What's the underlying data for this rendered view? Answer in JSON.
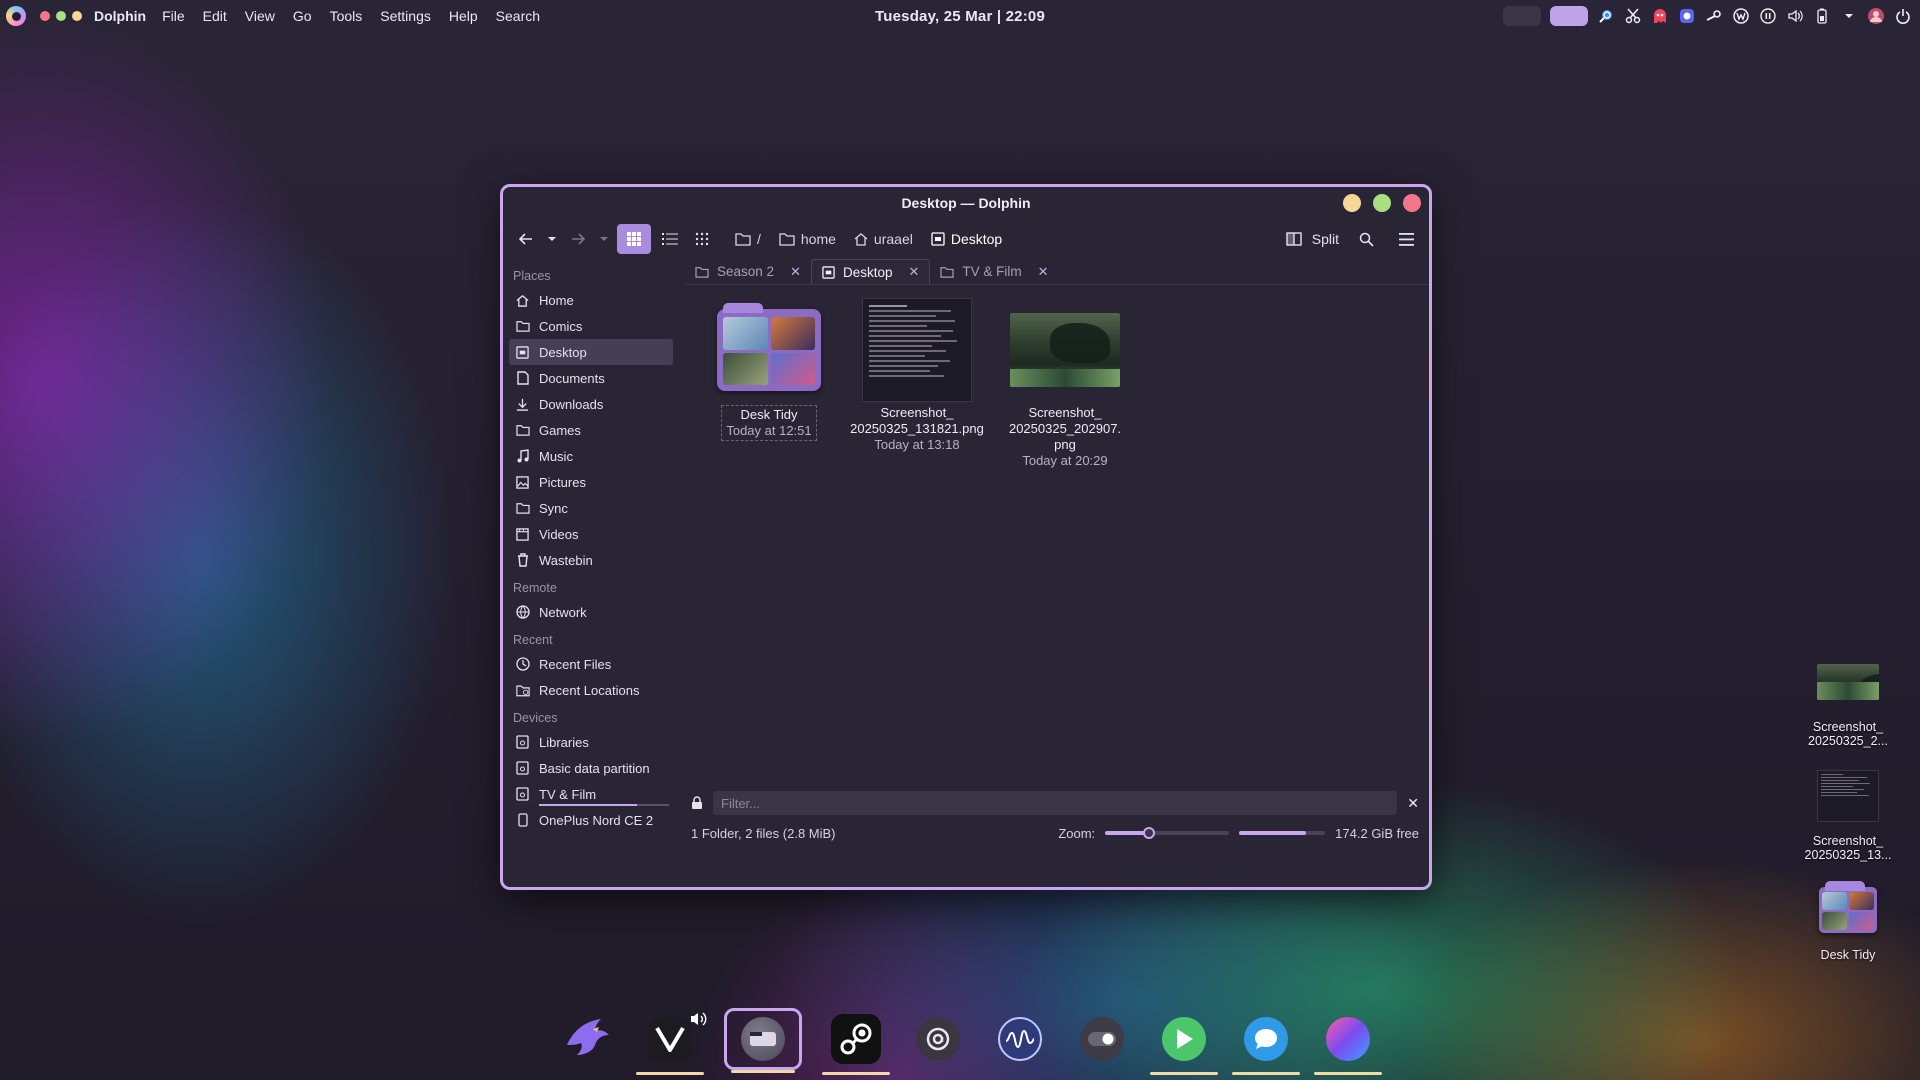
{
  "top_panel": {
    "app_name": "Dolphin",
    "menu": [
      "File",
      "Edit",
      "View",
      "Go",
      "Tools",
      "Settings",
      "Help",
      "Search"
    ],
    "clock": "Tuesday, 25 Mar | 22:09"
  },
  "window": {
    "title": "Desktop — Dolphin",
    "breadcrumb": {
      "root": "/",
      "home": "home",
      "user": "uraael",
      "current": "Desktop"
    },
    "split_label": "Split",
    "sidebar": {
      "places_header": "Places",
      "places": [
        {
          "label": "Home",
          "icon": "home-icon"
        },
        {
          "label": "Comics",
          "icon": "folder-icon"
        },
        {
          "label": "Desktop",
          "icon": "desktop-icon",
          "selected": true
        },
        {
          "label": "Documents",
          "icon": "document-icon"
        },
        {
          "label": "Downloads",
          "icon": "download-icon"
        },
        {
          "label": "Games",
          "icon": "folder-icon"
        },
        {
          "label": "Music",
          "icon": "music-icon"
        },
        {
          "label": "Pictures",
          "icon": "picture-icon"
        },
        {
          "label": "Sync",
          "icon": "folder-icon"
        },
        {
          "label": "Videos",
          "icon": "video-icon"
        },
        {
          "label": "Wastebin",
          "icon": "trash-icon"
        }
      ],
      "remote_header": "Remote",
      "remote": [
        {
          "label": "Network",
          "icon": "network-icon"
        }
      ],
      "recent_header": "Recent",
      "recent": [
        {
          "label": "Recent Files",
          "icon": "clock-icon"
        },
        {
          "label": "Recent Locations",
          "icon": "recent-folder-icon"
        }
      ],
      "devices_header": "Devices",
      "devices": [
        {
          "label": "Libraries",
          "icon": "drive-icon"
        },
        {
          "label": "Basic data partition",
          "icon": "drive-icon"
        },
        {
          "label": "TV & Film",
          "icon": "drive-icon",
          "usage": 0.75
        },
        {
          "label": "OnePlus Nord CE 2",
          "icon": "phone-icon"
        }
      ]
    },
    "tabs": [
      {
        "label": "Season 2",
        "icon": "folder-icon",
        "active": false
      },
      {
        "label": "Desktop",
        "icon": "desktop-icon",
        "active": true
      },
      {
        "label": "TV & Film",
        "icon": "folder-icon",
        "active": false
      }
    ],
    "files": [
      {
        "name": "Desk Tidy",
        "date": "Today at 12:51",
        "kind": "folder"
      },
      {
        "name": "Screenshot_\n20250325_131821.png",
        "name1": "Screenshot_",
        "name2": "20250325_131821.png",
        "date": "Today at 13:18",
        "kind": "doc"
      },
      {
        "name1": "Screenshot_",
        "name2": "20250325_202907.",
        "name3": "png",
        "date": "Today at 20:29",
        "kind": "image"
      }
    ],
    "filter_placeholder": "Filter...",
    "status": {
      "summary": "1 Folder, 2 files (2.8 MiB)",
      "zoom_label": "Zoom:",
      "zoom_level": 0.35,
      "free_space": "174.2 GiB free",
      "used_fraction": 0.78
    }
  },
  "desktop_icons": [
    {
      "line1": "Screenshot_",
      "line2": "20250325_2...",
      "kind": "image"
    },
    {
      "line1": "Screenshot_",
      "line2": "20250325_13...",
      "kind": "doc"
    },
    {
      "line1": "Desk Tidy",
      "line2": "",
      "kind": "folder"
    }
  ],
  "dock": [
    {
      "name": "eagle-browser-icon"
    },
    {
      "name": "vivaldi-icon"
    },
    {
      "name": "dolphin-icon",
      "active": true
    },
    {
      "name": "steam-icon"
    },
    {
      "name": "at-sign-app-icon"
    },
    {
      "name": "waveform-app-icon"
    },
    {
      "name": "toggle-app-icon"
    },
    {
      "name": "play-store-icon"
    },
    {
      "name": "chat-app-icon"
    },
    {
      "name": "gradient-app-icon"
    }
  ],
  "colors": {
    "accent": "#c9a6ef",
    "window_bg": "#2a2535",
    "minimize": "#f7d69a",
    "maximize": "#a7e07e",
    "close": "#f4768b"
  }
}
